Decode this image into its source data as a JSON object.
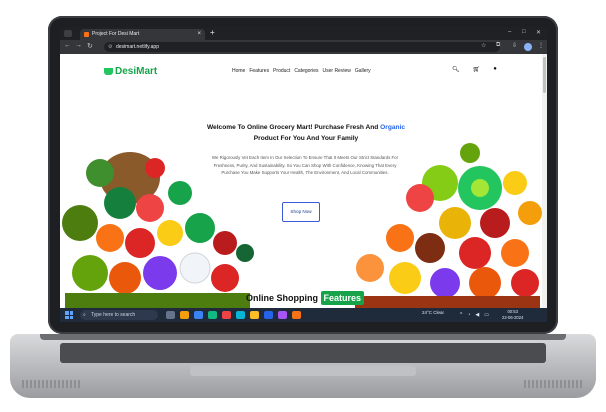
{
  "browser": {
    "tab_title": "Project For Desi Mart",
    "url": "desimart.netlify.app",
    "new_tab": "+",
    "close_tab": "×"
  },
  "site": {
    "logo": "DesiMart",
    "nav": [
      "Home",
      "Features",
      "Product",
      "Categories",
      "User Review",
      "Gallery"
    ]
  },
  "hero": {
    "title_part1": "Welcome To Online Grocery Mart! Purchase Fresh And",
    "title_highlight": "Organic",
    "title_part2": "Product For You And Your Family",
    "body": "We Rigorously Vet Each Item In Our Selection To Ensure That It Meets Our Strict Standards For Freshness, Purity, And Sustainability. So You Can Shop With Confidence, Knowing That Every Purchase You Make Supports Your Health, The Environment, And Local Communities.",
    "button": "Shop Now"
  },
  "features_heading": {
    "text": "Online Shopping",
    "badge": "Features"
  },
  "taskbar": {
    "search_placeholder": "Type here to search",
    "weather": "24°C  Clear",
    "time": "00:53",
    "date": "22-06-2024",
    "app_colors": [
      "#64748b",
      "#f59e0b",
      "#3b82f6",
      "#10b981",
      "#ef4444",
      "#06b6d4",
      "#fbbf24",
      "#2563eb",
      "#a855f7",
      "#f97316"
    ]
  },
  "colors": {
    "brand": "#16a34a",
    "highlight": "#2563eb",
    "button_border": "#3b5bdb"
  }
}
